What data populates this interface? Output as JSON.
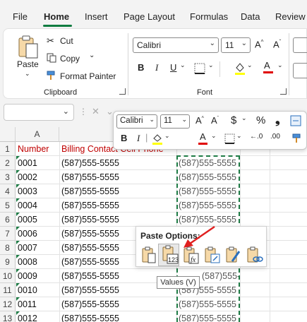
{
  "menu": {
    "tabs": [
      {
        "label": "File",
        "active": false
      },
      {
        "label": "Home",
        "active": true
      },
      {
        "label": "Insert",
        "active": false
      },
      {
        "label": "Page Layout",
        "active": false
      },
      {
        "label": "Formulas",
        "active": false
      },
      {
        "label": "Data",
        "active": false
      },
      {
        "label": "Review",
        "active": false
      }
    ]
  },
  "ribbon": {
    "clipboard": {
      "label": "Clipboard",
      "paste": "Paste",
      "cut": "Cut",
      "copy": "Copy",
      "format_painter": "Format Painter"
    },
    "font": {
      "label": "Font",
      "font_name": "Calibri",
      "font_size": "11"
    }
  },
  "mini_toolbar": {
    "font_name": "Calibri",
    "font_size": "11"
  },
  "sheet": {
    "column_a": "A",
    "header_number": "Number",
    "header_billing": "Billing Contact Cell Phone",
    "header_color": "#c00000",
    "rows": [
      {
        "num": "1"
      },
      {
        "num": "2",
        "id": "0001",
        "phone": "(587)555-5555",
        "copy": "(587)555-5555"
      },
      {
        "num": "3",
        "id": "0002",
        "phone": "(587)555-5555",
        "copy": "(587)555-5555"
      },
      {
        "num": "4",
        "id": "0003",
        "phone": "(587)555-5555",
        "copy": "(587)555-5555"
      },
      {
        "num": "5",
        "id": "0004",
        "phone": "(587)555-5555",
        "copy": "(587)555-5555"
      },
      {
        "num": "6",
        "id": "0005",
        "phone": "(587)555-5555",
        "copy": "(587)555-5555"
      },
      {
        "num": "7",
        "id": "0006",
        "phone": "(587)555-5555",
        "copy": "(587)555-5555"
      },
      {
        "num": "8",
        "id": "0007",
        "phone": "(587)555-5555",
        "copy": "(587)555-5555"
      },
      {
        "num": "9",
        "id": "0008",
        "phone": "(587)555-5555",
        "copy": "(587)555-5555"
      },
      {
        "num": "10",
        "id": "0009",
        "phone": "(587)555-5555",
        "copy": "(587)555-5555"
      },
      {
        "num": "11",
        "id": "0010",
        "phone": "(587)555-5555",
        "copy": "(587)555-5555"
      },
      {
        "num": "12",
        "id": "0011",
        "phone": "(587)555-5555",
        "copy": "(587)555-5555"
      },
      {
        "num": "13",
        "id": "0012",
        "phone": "(587)555-5555",
        "copy": "(587)555-5555"
      }
    ]
  },
  "paste_options": {
    "title": "Paste Options:",
    "tooltip": "Values (V)"
  },
  "colors": {
    "accent": "#107c41",
    "marquee": "#1e7b45",
    "annotation_arrow": "#e02020"
  }
}
